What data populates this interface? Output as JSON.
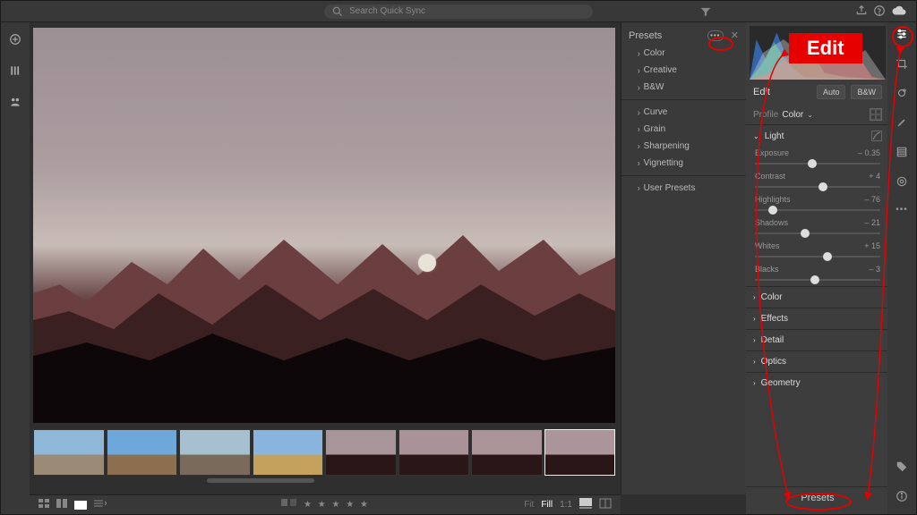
{
  "search": {
    "placeholder": "Search Quick Sync"
  },
  "presets_panel": {
    "title": "Presets",
    "groups1": [
      "Color",
      "Creative",
      "B&W"
    ],
    "groups2": [
      "Curve",
      "Grain",
      "Sharpening",
      "Vignetting"
    ],
    "groups3": [
      "User Presets"
    ]
  },
  "edit": {
    "title": "Edit",
    "auto": "Auto",
    "bw": "B&W",
    "profile_label": "Profile",
    "profile_value": "Color",
    "light": {
      "title": "Light",
      "sliders": [
        {
          "name": "Exposure",
          "value": "– 0.35",
          "pos": 46
        },
        {
          "name": "Contrast",
          "value": "+ 4",
          "pos": 54
        },
        {
          "name": "Highlights",
          "value": "– 76",
          "pos": 14
        },
        {
          "name": "Shadows",
          "value": "– 21",
          "pos": 40
        },
        {
          "name": "Whites",
          "value": "+ 15",
          "pos": 58
        },
        {
          "name": "Blacks",
          "value": "– 3",
          "pos": 48
        }
      ]
    },
    "collapsed": [
      "Color",
      "Effects",
      "Detail",
      "Optics",
      "Geometry"
    ],
    "presets_button": "Presets"
  },
  "bottom": {
    "fit": "Fit",
    "fill": "Fill",
    "one_to_one": "1:1"
  },
  "annotation": {
    "edit_label": "Edit"
  },
  "thumbnails": [
    {
      "sky": "#8fb8d8",
      "ground": "#9a8a76"
    },
    {
      "sky": "#6ea7da",
      "ground": "#8c6f4f"
    },
    {
      "sky": "#a7c0d0",
      "ground": "#7a6a5c"
    },
    {
      "sky": "#88b4dd",
      "ground": "#c4a25e"
    },
    {
      "sky": "#a89599",
      "ground": "#2a1517"
    },
    {
      "sky": "#a99398",
      "ground": "#2a1517"
    },
    {
      "sky": "#aa9498",
      "ground": "#2a1517"
    },
    {
      "sky": "#ab959a",
      "ground": "#2a1517",
      "sel": true
    }
  ]
}
